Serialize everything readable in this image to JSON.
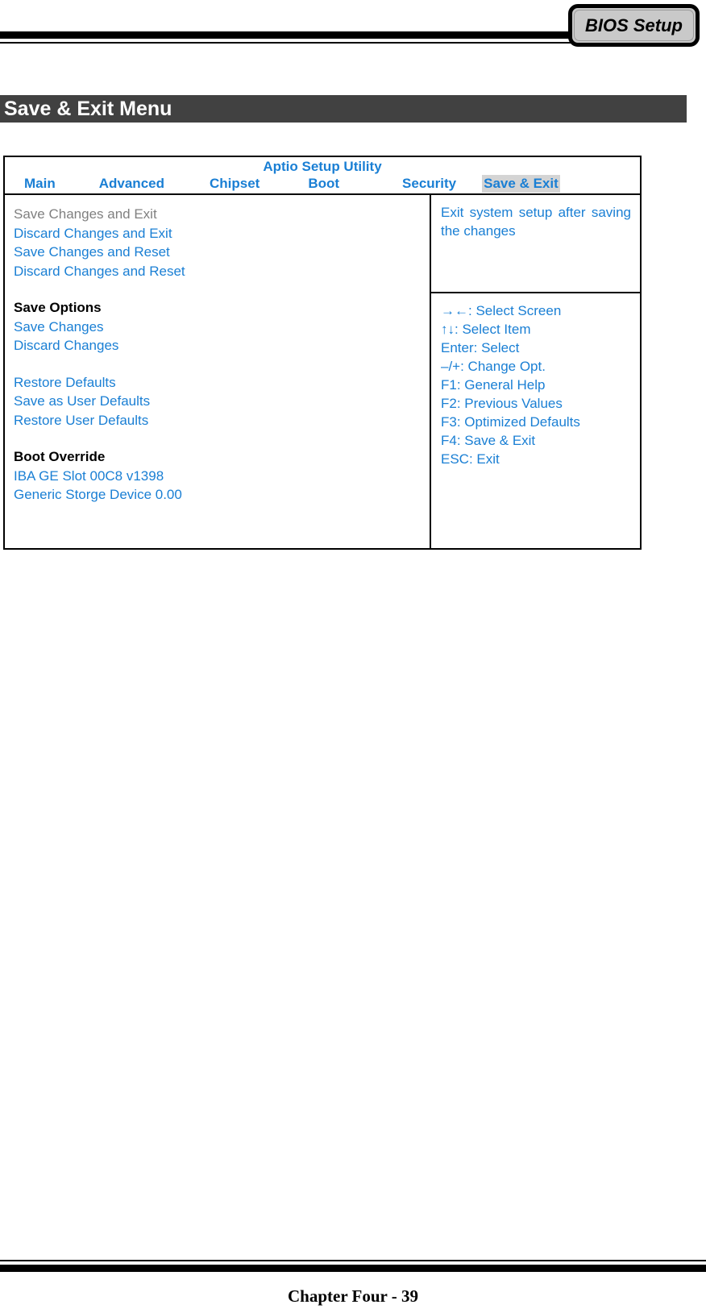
{
  "page": {
    "corner_tab_label": "BIOS Setup",
    "section_title": "Save & Exit Menu",
    "footer": "Chapter Four - 39"
  },
  "bios": {
    "utility_title": "Aptio Setup Utility",
    "tabs": [
      {
        "label": "Main",
        "active": false
      },
      {
        "label": "Advanced",
        "active": false
      },
      {
        "label": "Chipset",
        "active": false
      },
      {
        "label": "Boot",
        "active": false
      },
      {
        "label": "Security",
        "active": false
      },
      {
        "label": "Save & Exit",
        "active": true
      }
    ],
    "menu_items": [
      {
        "label": "Save Changes and Exit",
        "style": "dim"
      },
      {
        "label": "Discard Changes and Exit",
        "style": "link"
      },
      {
        "label": "Save Changes and Reset",
        "style": "link"
      },
      {
        "label": "Discard Changes and Reset",
        "style": "link"
      },
      {
        "label": "",
        "style": "gap"
      },
      {
        "label": "Save Options",
        "style": "group"
      },
      {
        "label": "Save Changes",
        "style": "link"
      },
      {
        "label": "Discard Changes",
        "style": "link"
      },
      {
        "label": "",
        "style": "gap"
      },
      {
        "label": "Restore Defaults",
        "style": "link"
      },
      {
        "label": "Save as User Defaults",
        "style": "link"
      },
      {
        "label": "Restore User Defaults",
        "style": "link"
      },
      {
        "label": "",
        "style": "gap"
      },
      {
        "label": "Boot Override",
        "style": "group"
      },
      {
        "label": "IBA GE Slot 00C8 v1398",
        "style": "link"
      },
      {
        "label": "Generic Storge Device 0.00",
        "style": "link"
      }
    ],
    "help_description": "Exit system setup after saving the changes",
    "help_keys": [
      "→←: Select Screen",
      "↑↓: Select Item",
      "Enter: Select",
      "–/+: Change Opt.",
      "F1: General Help",
      "F2: Previous Values",
      "F3: Optimized Defaults",
      "F4: Save & Exit",
      "ESC: Exit"
    ]
  },
  "colors": {
    "link_blue": "#1a7fd4",
    "dim_gray": "#808080",
    "tab_highlight": "#d4d4d4",
    "section_bar": "#414141",
    "corner_tab_fill": "#c9c9c9"
  }
}
